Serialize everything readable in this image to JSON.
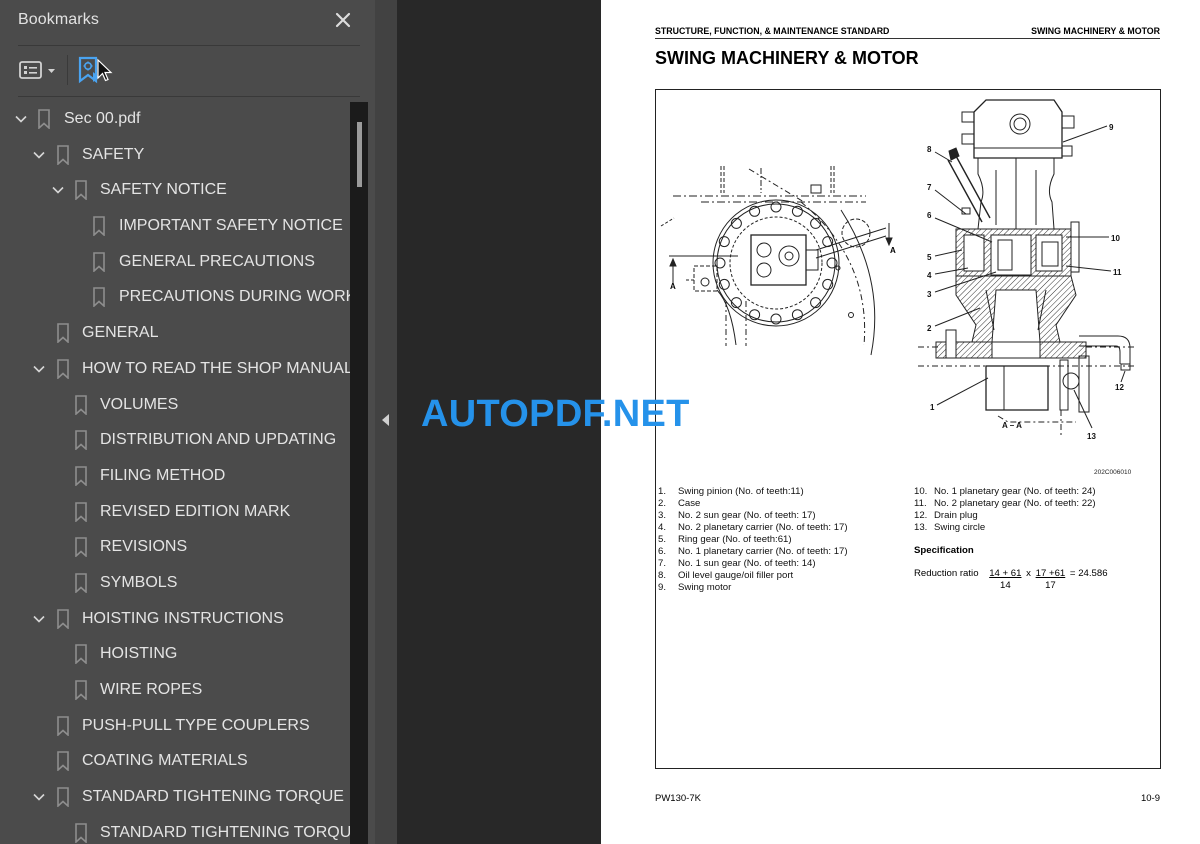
{
  "sidebar": {
    "title": "Bookmarks",
    "close_icon": "close-icon",
    "toolbar": {
      "options_icon": "list-options-icon",
      "options_caret": "caret-down-icon",
      "bookmark_settings_icon": "bookmark-settings-icon"
    },
    "tree": [
      {
        "label": "Sec 00.pdf",
        "level": 0,
        "expanded": true
      },
      {
        "label": "SAFETY",
        "level": 1,
        "expanded": true
      },
      {
        "label": "SAFETY NOTICE",
        "level": 2,
        "expanded": true
      },
      {
        "label": "IMPORTANT SAFETY NOTICE",
        "level": 3
      },
      {
        "label": "GENERAL PRECAUTIONS",
        "level": 3
      },
      {
        "label": "PRECAUTIONS DURING WORK",
        "level": 3
      },
      {
        "label": "GENERAL",
        "level": 1
      },
      {
        "label": "HOW TO READ THE SHOP MANUAL",
        "level": 1,
        "expanded": true
      },
      {
        "label": "VOLUMES",
        "level": 2
      },
      {
        "label": "DISTRIBUTION AND UPDATING",
        "level": 2
      },
      {
        "label": "FILING METHOD",
        "level": 2
      },
      {
        "label": "REVISED EDITION MARK",
        "level": 2
      },
      {
        "label": "REVISIONS",
        "level": 2
      },
      {
        "label": "SYMBOLS",
        "level": 2
      },
      {
        "label": "HOISTING INSTRUCTIONS",
        "level": 1,
        "expanded": true
      },
      {
        "label": "HOISTING",
        "level": 2
      },
      {
        "label": "WIRE ROPES",
        "level": 2
      },
      {
        "label": "PUSH-PULL TYPE COUPLERS",
        "level": 1
      },
      {
        "label": "COATING MATERIALS",
        "level": 1
      },
      {
        "label": "STANDARD TIGHTENING TORQUE",
        "level": 1,
        "expanded": true
      },
      {
        "label": "STANDARD TIGHTENING TORQUE",
        "level": 2
      }
    ]
  },
  "watermark": "AUTOPDF.NET",
  "page": {
    "header_left": "STRUCTURE, FUNCTION, & MAINTENANCE STANDARD",
    "header_right": "SWING MACHINERY & MOTOR",
    "title": "SWING MACHINERY & MOTOR",
    "figure": {
      "code": "202C006010",
      "section_marks": [
        "A",
        "A"
      ],
      "section_view_label": "A – A",
      "callouts": [
        "9",
        "8",
        "7",
        "6",
        "10",
        "5",
        "11",
        "4",
        "3",
        "2",
        "12",
        "1",
        "13"
      ]
    },
    "legend_left": [
      {
        "num": "1.",
        "text": "Swing pinion (No. of teeth:11)"
      },
      {
        "num": "2.",
        "text": "Case"
      },
      {
        "num": "3.",
        "text": "No. 2 sun gear (No. of teeth: 17)"
      },
      {
        "num": "4.",
        "text": "No. 2 planetary carrier (No. of teeth: 17)"
      },
      {
        "num": "5.",
        "text": "Ring gear (No. of teeth:61)"
      },
      {
        "num": "6.",
        "text": "No. 1 planetary carrier (No. of teeth: 17)"
      },
      {
        "num": "7.",
        "text": "No. 1 sun gear (No. of teeth: 14)"
      },
      {
        "num": "8.",
        "text": "Oil level gauge/oil filler port"
      },
      {
        "num": "9.",
        "text": "Swing motor"
      }
    ],
    "legend_right": [
      {
        "num": "10.",
        "text": "No. 1 planetary gear (No. of teeth: 24)"
      },
      {
        "num": "11.",
        "text": "No. 2 planetary gear (No. of teeth: 22)"
      },
      {
        "num": "12.",
        "text": "Drain plug"
      },
      {
        "num": "13.",
        "text": "Swing circle"
      }
    ],
    "specification": {
      "title": "Specification",
      "label": "Reduction ratio",
      "frac1_num": "14 + 61",
      "frac1_den": "14",
      "times": "x",
      "frac2_num": "17 +61",
      "frac2_den": "17",
      "result": "= 24.586"
    },
    "footer_left": "PW130-7K",
    "footer_right": "10-9"
  }
}
